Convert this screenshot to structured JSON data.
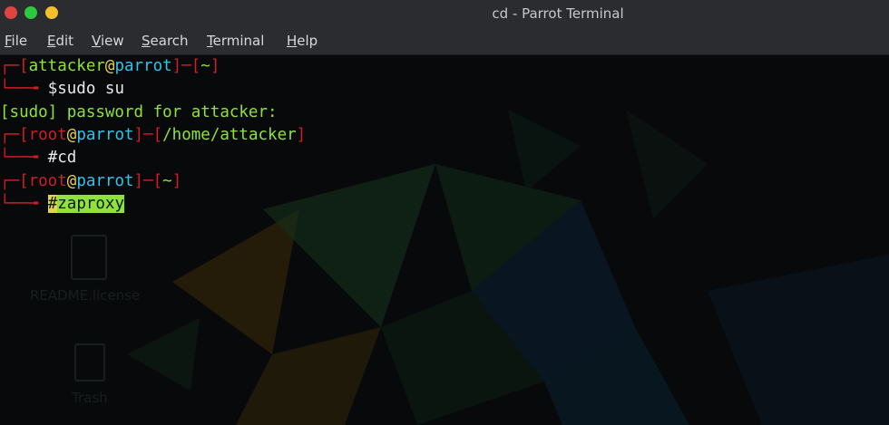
{
  "window": {
    "title": "cd - Parrot Terminal"
  },
  "menu": {
    "file": {
      "accel": "F",
      "rest": "ile"
    },
    "edit": {
      "accel": "E",
      "rest": "dit"
    },
    "view": {
      "accel": "V",
      "rest": "iew"
    },
    "search": {
      "accel": "S",
      "rest": "earch"
    },
    "terminal": {
      "accel": "T",
      "rest": "erminal"
    },
    "help": {
      "accel": "H",
      "rest": "elp"
    }
  },
  "terminal": {
    "lines": [
      {
        "user": "attacker",
        "host": "parrot",
        "dir": "~"
      },
      {
        "prompt": "$",
        "cmd": "sudo su"
      },
      {
        "text": "[sudo] password for attacker:"
      },
      {
        "user": "root",
        "host": "parrot",
        "dir": "/home/attacker"
      },
      {
        "prompt": "#",
        "cmd": "cd"
      },
      {
        "user": "root",
        "host": "parrot",
        "dir": "~"
      },
      {
        "prompt": "#",
        "cmd_a": "za",
        "cmd_b": "proxy"
      }
    ]
  },
  "desktop": {
    "file_label": "README.license",
    "trash_label": "Trash"
  },
  "colors": {
    "prompt_bracket": "#cc1f26",
    "green": "#8ee23b",
    "cyan": "#31c4e8",
    "selection": "#8ee23b"
  }
}
